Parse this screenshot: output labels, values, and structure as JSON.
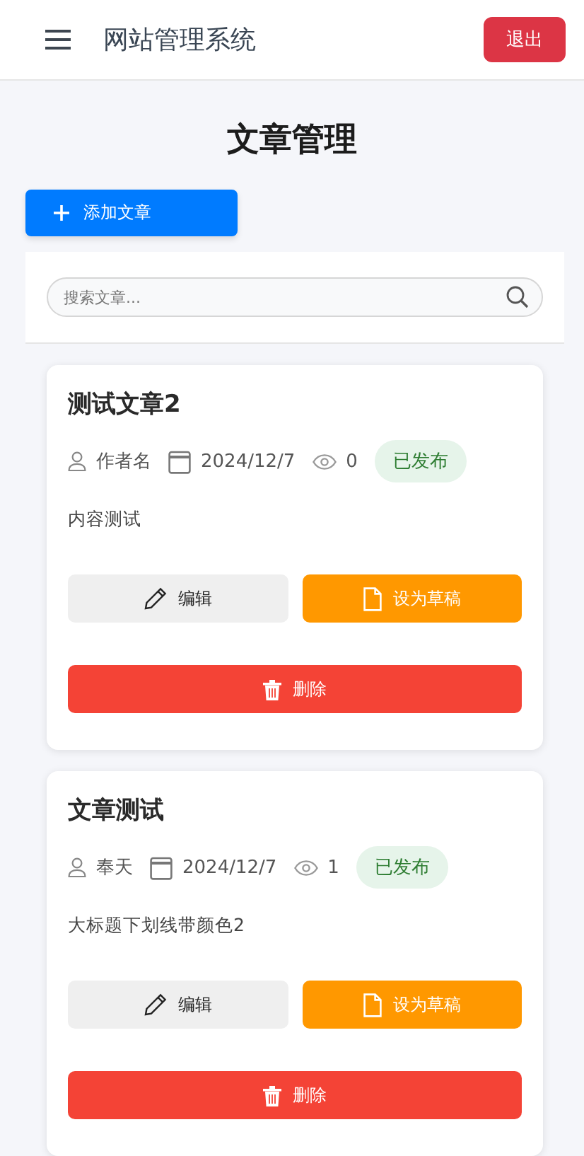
{
  "header": {
    "title": "网站管理系统",
    "logout": "退出"
  },
  "page_title": "文章管理",
  "add_button": "添加文章",
  "search": {
    "placeholder": "搜索文章..."
  },
  "articles": [
    {
      "title": "测试文章2",
      "author": "作者名",
      "date": "2024/12/7",
      "views": "0",
      "status": {
        "label": "已发布",
        "kind": "published"
      },
      "content": "内容测试",
      "edit": "编辑",
      "draft": "设为草稿",
      "delete": "删除"
    },
    {
      "title": "文章测试",
      "author": "奉天",
      "date": "2024/12/7",
      "views": "1",
      "status": {
        "label": "已发布",
        "kind": "published"
      },
      "content": "大标题下划线带颜色2",
      "edit": "编辑",
      "draft": "设为草稿",
      "delete": "删除"
    }
  ]
}
